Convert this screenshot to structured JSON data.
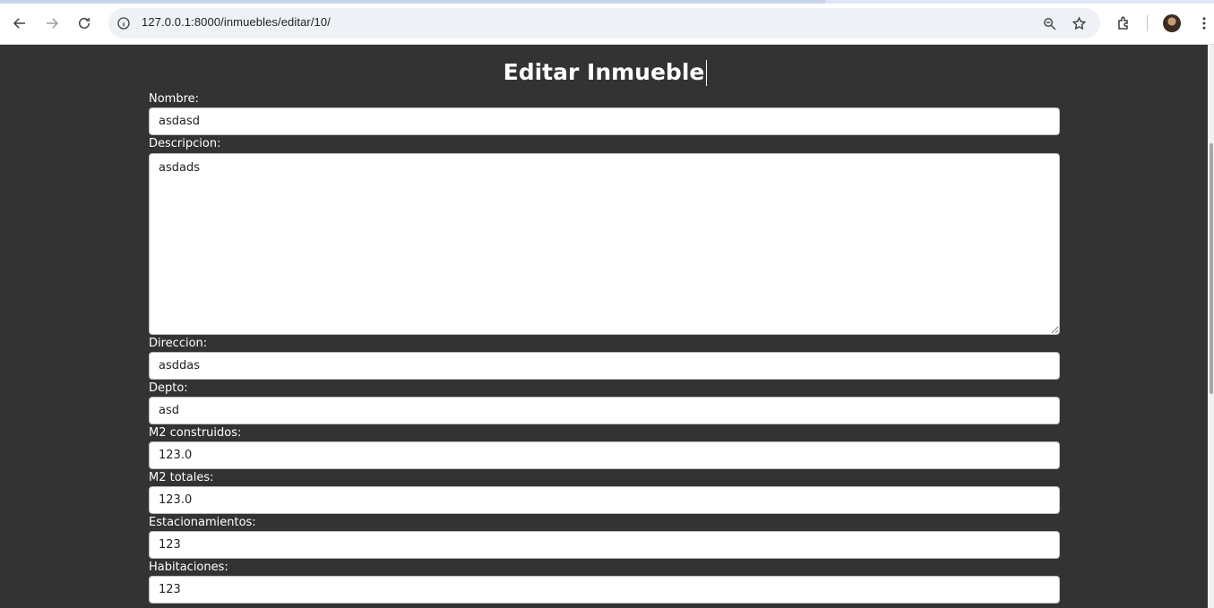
{
  "browser": {
    "url": "127.0.0.1:8000/inmuebles/editar/10/",
    "icons": [
      "back-arrow-icon",
      "forward-arrow-icon",
      "reload-icon",
      "site-info-icon",
      "zoom-icon",
      "bookmark-star-icon",
      "extensions-icon",
      "profile-avatar",
      "kebab-menu-icon"
    ]
  },
  "page": {
    "title": "Editar Inmueble",
    "background": "#333333"
  },
  "form": {
    "nombre": {
      "label": "Nombre:",
      "value": "asdasd"
    },
    "descripcion": {
      "label": "Descripcion:",
      "value": "asdads"
    },
    "direccion": {
      "label": "Direccion:",
      "value": "asddas"
    },
    "depto": {
      "label": "Depto:",
      "value": "asd"
    },
    "m2_construidos": {
      "label": "M2 construidos:",
      "value": "123.0"
    },
    "m2_totales": {
      "label": "M2 totales:",
      "value": "123.0"
    },
    "estacionamientos": {
      "label": "Estacionamientos:",
      "value": "123"
    },
    "habitaciones": {
      "label": "Habitaciones:",
      "value": "123"
    }
  }
}
